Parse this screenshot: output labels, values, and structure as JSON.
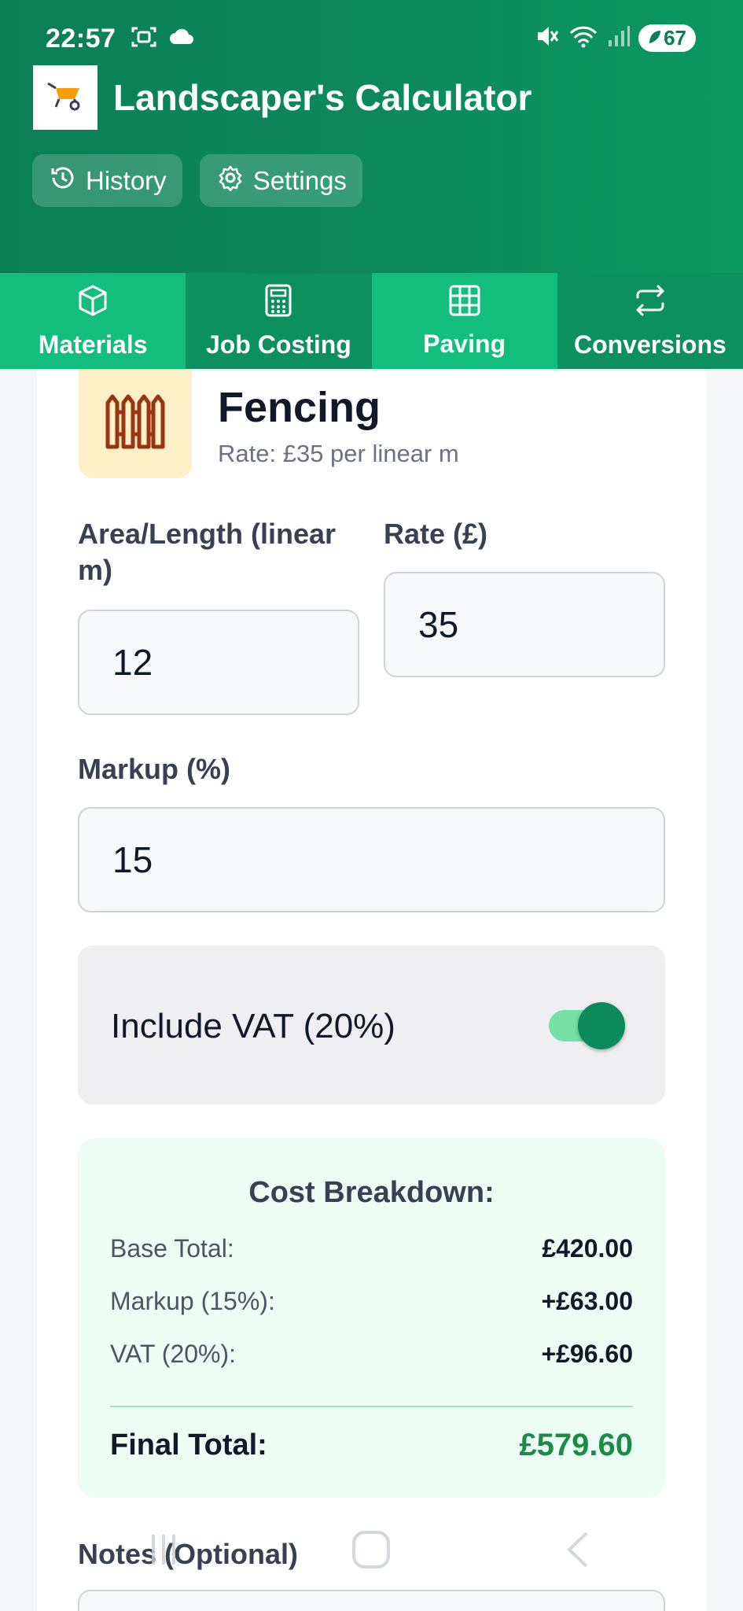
{
  "status_bar": {
    "time": "22:57",
    "battery": "67"
  },
  "app": {
    "title": "Landscaper's Calculator"
  },
  "header_buttons": {
    "history": "History",
    "settings": "Settings"
  },
  "tabs": [
    {
      "label": "Materials",
      "icon": "box-icon"
    },
    {
      "label": "Job Costing",
      "icon": "calculator-icon"
    },
    {
      "label": "Paving",
      "icon": "grid-icon"
    },
    {
      "label": "Conversions",
      "icon": "arrows-swap-icon"
    }
  ],
  "section": {
    "title": "Fencing",
    "rate_text": "Rate: £35 per linear m",
    "icon": "fence-icon"
  },
  "form": {
    "length_label": "Area/Length (linear m)",
    "length_value": "12",
    "rate_label": "Rate (£)",
    "rate_value": "35",
    "markup_label": "Markup (%)",
    "markup_value": "15",
    "vat_label": "Include VAT (20%)",
    "vat_enabled": true
  },
  "breakdown": {
    "title": "Cost Breakdown:",
    "rows": [
      {
        "label": "Base Total:",
        "value": "£420.00"
      },
      {
        "label": "Markup (15%):",
        "value": "+£63.00"
      },
      {
        "label": "VAT (20%):",
        "value": "+£96.60"
      }
    ],
    "final_label": "Final Total:",
    "final_value": "£579.60"
  },
  "notes": {
    "label": "Notes (Optional)"
  },
  "colors": {
    "primary": "#0c8a5c",
    "tab_light": "#12bd7e",
    "tab_dark": "#0c9060",
    "breakdown_bg": "#ecfdf3",
    "final_total": "#1d8a4a"
  }
}
